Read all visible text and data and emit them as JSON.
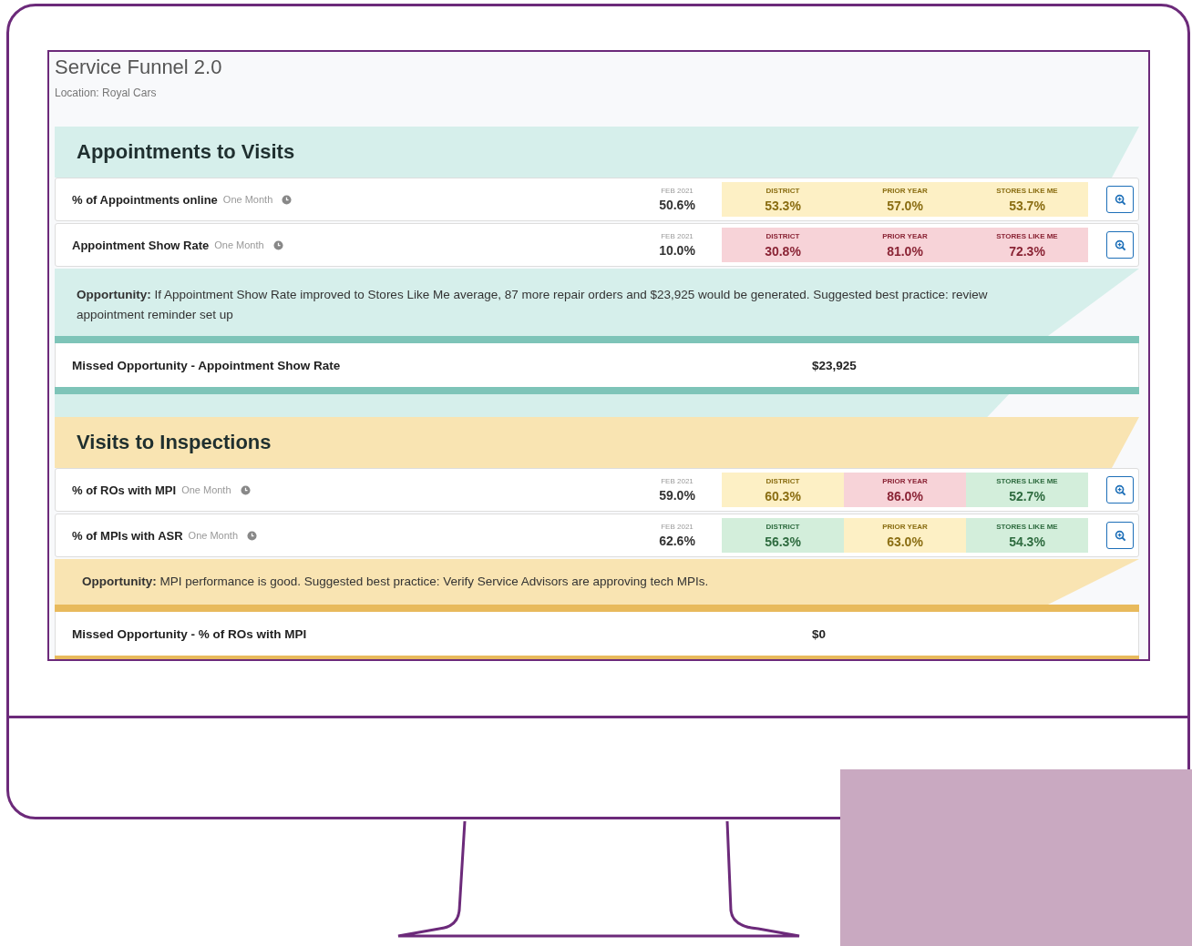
{
  "title": "Service Funnel 2.0",
  "location": "Location: Royal Cars",
  "sections": [
    {
      "title": "Appointments to Visits",
      "color": "#d6efeb",
      "metrics": [
        {
          "label": "% of Appointments online",
          "period": "One Month",
          "date": "FEB 2021",
          "value": "50.6%",
          "comparisons": [
            {
              "label": "DISTRICT",
              "value": "53.3%",
              "color": "#fdf0c5"
            },
            {
              "label": "PRIOR YEAR",
              "value": "57.0%",
              "color": "#fdf0c5"
            },
            {
              "label": "STORES LIKE ME",
              "value": "53.7%",
              "color": "#fdf0c5"
            }
          ]
        },
        {
          "label": "Appointment Show Rate",
          "period": "One Month",
          "date": "FEB 2021",
          "value": "10.0%",
          "comparisons": [
            {
              "label": "DISTRICT",
              "value": "30.8%",
              "color": "#f7d3d8"
            },
            {
              "label": "PRIOR YEAR",
              "value": "81.0%",
              "color": "#f7d3d8"
            },
            {
              "label": "STORES LIKE ME",
              "value": "72.3%",
              "color": "#f7d3d8"
            }
          ]
        }
      ],
      "opportunity": "**Opportunity:** If Appointment Show Rate improved to Stores Like Me average, 87 more repair orders and $23,925 would be generated. Suggested best practice: review appointment reminder set up",
      "missed": {
        "label": "Missed Opportunity - Appointment Show Rate",
        "value": "$23,925"
      }
    },
    {
      "title": "Visits to Inspections",
      "color": "#f9e4b2",
      "metrics": [
        {
          "label": "% of ROs with MPI",
          "period": "One Month",
          "date": "FEB 2021",
          "value": "59.0%",
          "comparisons": [
            {
              "label": "DISTRICT",
              "value": "60.3%",
              "color": "#fdf0c5"
            },
            {
              "label": "PRIOR YEAR",
              "value": "86.0%",
              "color": "#f7d3d8"
            },
            {
              "label": "STORES LIKE ME",
              "value": "52.7%",
              "color": "#d3eedb"
            }
          ]
        },
        {
          "label": "% of MPIs with ASR",
          "period": "One Month",
          "date": "FEB 2021",
          "value": "62.6%",
          "comparisons": [
            {
              "label": "DISTRICT",
              "value": "56.3%",
              "color": "#d3eedb"
            },
            {
              "label": "PRIOR YEAR",
              "value": "63.0%",
              "color": "#fdf0c5"
            },
            {
              "label": "STORES LIKE ME",
              "value": "54.3%",
              "color": "#d3eedb"
            }
          ]
        }
      ],
      "opportunity": "**Opportunity:** MPI performance is good. Suggested best practice: Verify Service Advisors are approving tech MPIs.",
      "missed": {
        "label": "Missed Opportunity - % of ROs with MPI",
        "value": "$0"
      }
    }
  ]
}
